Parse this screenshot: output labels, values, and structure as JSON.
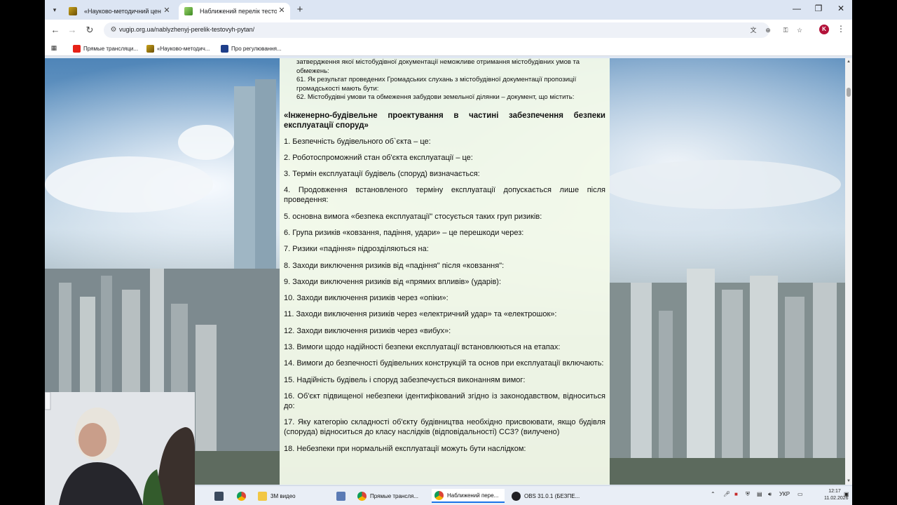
{
  "browser": {
    "tabs": [
      {
        "title": "«Науково-методичний центр",
        "active": false
      },
      {
        "title": "Наближений перелік тестови",
        "active": true
      }
    ],
    "url": "vugip.org.ua/nablyzhenyj-perelik-testovyh-pytan/",
    "profile_initial": "K",
    "bookmarks": [
      {
        "label": "Прямые трансляци..."
      },
      {
        "label": "«Науково-методич..."
      },
      {
        "label": "Про регулювання..."
      }
    ]
  },
  "page": {
    "top_fragments": [
      "затвердження якої містобудівної документації неможливе отримання містобудівних умов та обмежень:",
      "61. Як результат проведених Громадських слухань з містобудівної документації пропозиції громадськості мають бути:",
      "62. Містобудівні умови та обмеження забудови земельної ділянки – документ, що містить:"
    ],
    "heading": "«Інженерно-будівельне проектування в частині забезпечення безпеки експлуатації споруд»",
    "questions": [
      "1. Безпечність будівельного об`єкта – це:",
      "2. Роботоспроможний стан об'єкта експлуатації – це:",
      "3. Термін експлуатації будівель (споруд) визначається:",
      "4. Продовження встановленого терміну експлуатації допускається лише після проведення:",
      "5. основна вимога «безпека експлуатації\" стосується таких груп ризиків:",
      "6. Група ризиків «ковзання, падіння, удари» – це перешкоди через:",
      "7. Ризики «падіння» підрозділяються на:",
      "8. Заходи виключення ризиків від «падіння\" після «ковзання\":",
      "9. Заходи виключення ризиків від «прямих впливів» (ударів):",
      "10. Заходи виключення ризиків через «опіки»:",
      "11. Заходи виключення ризиків через «електричний удар» та «електрошок»:",
      "12. Заходи виключення ризиків через «вибух»:",
      "13. Вимоги щодо надійності безпеки експлуатації встановлюються на етапах:",
      "14. Вимоги до безпечності будівельних конструкцій та основ при експлуатації включають:",
      "15. Надійність будівель і споруд забезпечується виконанням вимог:",
      "16. Об'єкт підвищеної небезпеки ідентифікований згідно із законодавством, відноситься до:",
      "17. Яку категорію складності об'єкту будівництва необхідно присвоювати, якщо будівля (споруда) відноситься до класу наслідків (відповідальності) СС3? (вилучено)",
      "18. Небезпеки при нормальній експлуатації можуть бути наслідком:"
    ]
  },
  "taskbar": {
    "items": [
      {
        "label": "3М видео",
        "active": false
      },
      {
        "label": "Прямые трансля...",
        "active": false
      },
      {
        "label": "Наближений пере...",
        "active": true
      },
      {
        "label": "OBS 31.0.1 (БЕЗПЕ...",
        "active": false
      }
    ],
    "language": "УКР",
    "time": "12:17",
    "date": "11.02.2026"
  },
  "colors": {
    "page_panel": "#f3faea",
    "active_tab_indicator": "#1a73e8",
    "profile": "#b3123a"
  }
}
